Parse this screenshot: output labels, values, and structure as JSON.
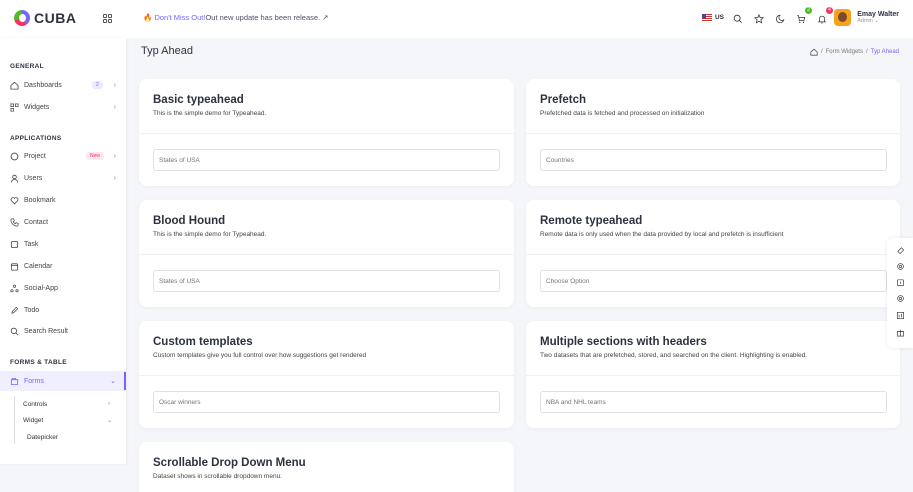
{
  "brand": {
    "name": "CUBA"
  },
  "header": {
    "notice_prefix": "Don't Miss Out!",
    "notice_text": "Out new update has been release.",
    "language": "US",
    "cart_count": "2",
    "notif_count": "4",
    "user_name": "Emay Walter",
    "user_role": "Admin",
    "colors": {
      "accent": "#7366ff",
      "success": "#51bb25",
      "danger": "#f73164",
      "warning": "#f8a11b"
    }
  },
  "sidebar": {
    "general_title": "GENERAL",
    "dashboards": "Dashboards",
    "dashboards_badge": "2",
    "widgets": "Widgets",
    "applications_title": "APPLICATIONS",
    "project": "Project",
    "project_badge": "New",
    "users": "Users",
    "bookmark": "Bookmark",
    "contact": "Contact",
    "task": "Task",
    "calendar": "Calendar",
    "social_app": "Social-App",
    "todo": "Todo",
    "search_result": "Search Result",
    "forms_title": "FORMS & TABLE",
    "forms": "Forms",
    "controls": "Controls",
    "widget": "Widget",
    "datepicker": "Datepicker"
  },
  "page": {
    "title": "Typ Ahead",
    "crumb_1": "Form Widgets",
    "crumb_2": "Typ Ahead"
  },
  "cards": [
    {
      "title": "Basic typeahead",
      "subtitle": "This is the simple demo for Typeahead.",
      "placeholder": "States of USA"
    },
    {
      "title": "Prefetch",
      "subtitle": "Prefetched data is fetched and processed on initialization",
      "placeholder": "Countries"
    },
    {
      "title": "Blood Hound",
      "subtitle": "This is the simple demo for Typeahead.",
      "placeholder": "States of USA"
    },
    {
      "title": "Remote typeahead",
      "subtitle": "Remote data is only used when the data provided by local and prefetch is insufficient",
      "placeholder": "Choose Option"
    },
    {
      "title": "Custom templates",
      "subtitle": "Custom templates give you full control over how suggestions get rendered",
      "placeholder": "Oscar winners"
    },
    {
      "title": "Multiple sections with headers",
      "subtitle": "Two datasets that are prefetched, stored, and searched on the client. Highlighting is enabled.",
      "placeholder": "NBA and NHL teams"
    },
    {
      "title": "Scrollable Drop Down Menu",
      "subtitle": "Dataset shows in scrollable dropdown menu."
    }
  ],
  "icons": [
    "grid-icon",
    "fire-icon",
    "external-link-icon",
    "search-icon",
    "star-icon",
    "moon-icon",
    "cart-icon",
    "bell-icon",
    "home-icon",
    "chevron-right-icon",
    "chevron-down-icon"
  ]
}
